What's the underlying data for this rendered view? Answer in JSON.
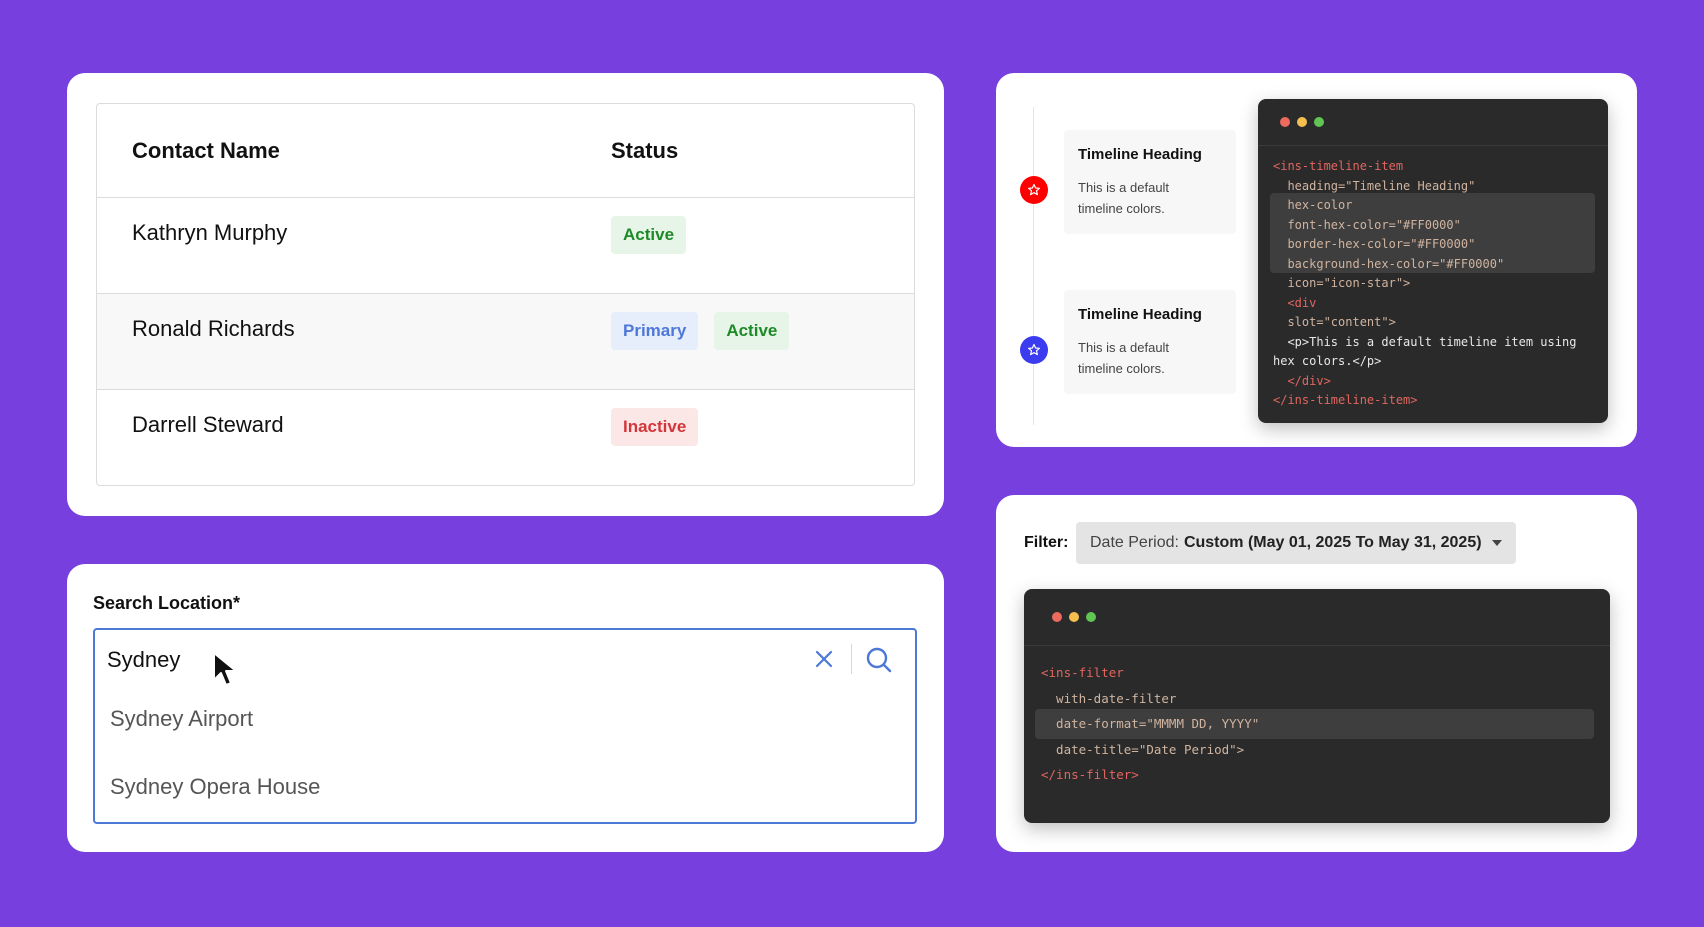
{
  "contacts_table": {
    "headers": {
      "name": "Contact Name",
      "status": "Status"
    },
    "rows": [
      {
        "name": "Kathryn Murphy",
        "badges": [
          {
            "label": "Active",
            "kind": "active"
          }
        ]
      },
      {
        "name": "Ronald Richards",
        "badges": [
          {
            "label": "Primary",
            "kind": "primary"
          },
          {
            "label": "Active",
            "kind": "active"
          }
        ]
      },
      {
        "name": "Darrell Steward",
        "badges": [
          {
            "label": "Inactive",
            "kind": "inactive"
          }
        ]
      }
    ]
  },
  "search": {
    "label": "Search Location*",
    "value": "Sydney",
    "suggestions": [
      "Sydney Airport",
      "Sydney Opera House"
    ],
    "clear_icon": "close-icon",
    "search_icon": "search-icon"
  },
  "timeline": {
    "items": [
      {
        "heading": "Timeline Heading",
        "text_line1": "This is a default",
        "text_line2": "timeline colors.",
        "icon": "star-icon",
        "color": "#FF0000"
      },
      {
        "heading": "Timeline Heading",
        "text_line1": "This is a default",
        "text_line2": "timeline colors.",
        "icon": "star-icon",
        "color": "#3B3BEF"
      }
    ]
  },
  "code_timeline": [
    "<ins-timeline-item",
    "  heading=\"Timeline Heading\"",
    "  hex-color",
    "  font-hex-color=\"#FF0000\"",
    "  border-hex-color=\"#FF0000\"",
    "  background-hex-color=\"#FF0000\"",
    "  icon=\"icon-star\">",
    "  <div",
    "  slot=\"content\">",
    "  <p>This is a default timeline item using",
    "hex colors.</p>",
    "  </div>",
    "</ins-timeline-item>"
  ],
  "filter": {
    "label": "Filter:",
    "select_prefix": "Date Period:",
    "select_value": "Custom (May 01, 2025 To May 31, 2025)"
  },
  "code_filter": [
    "<ins-filter",
    "  with-date-filter",
    "  date-format=\"MMMM DD, YYYY\"",
    "  date-title=\"Date Period\">",
    "</ins-filter>"
  ],
  "colors": {
    "background": "#7740DE",
    "accent_blue": "#4C78D6",
    "active_green": "#1E8A27",
    "inactive_red": "#D2363A",
    "window_dot_red": "#EC6A5E",
    "window_dot_yellow": "#F4BF4F",
    "window_dot_green": "#61C554"
  }
}
